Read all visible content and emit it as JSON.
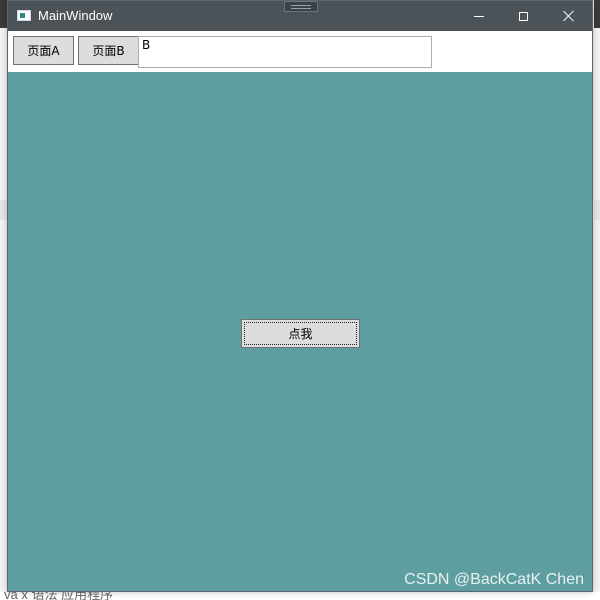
{
  "window": {
    "title": "MainWindow",
    "controls": {
      "minimize_icon": "minimize-icon",
      "maximize_icon": "maximize-icon",
      "close_icon": "close-icon"
    }
  },
  "toolbar": {
    "page_a_label": "页面A",
    "page_b_label": "页面B",
    "text_value": "B"
  },
  "content": {
    "background_color": "#5f9ea0",
    "center_button_label": "点我"
  },
  "watermark": "CSDN @BackCatK Chen",
  "background_fragments": {
    "bottom_text": "va x   语法   应用程序"
  }
}
